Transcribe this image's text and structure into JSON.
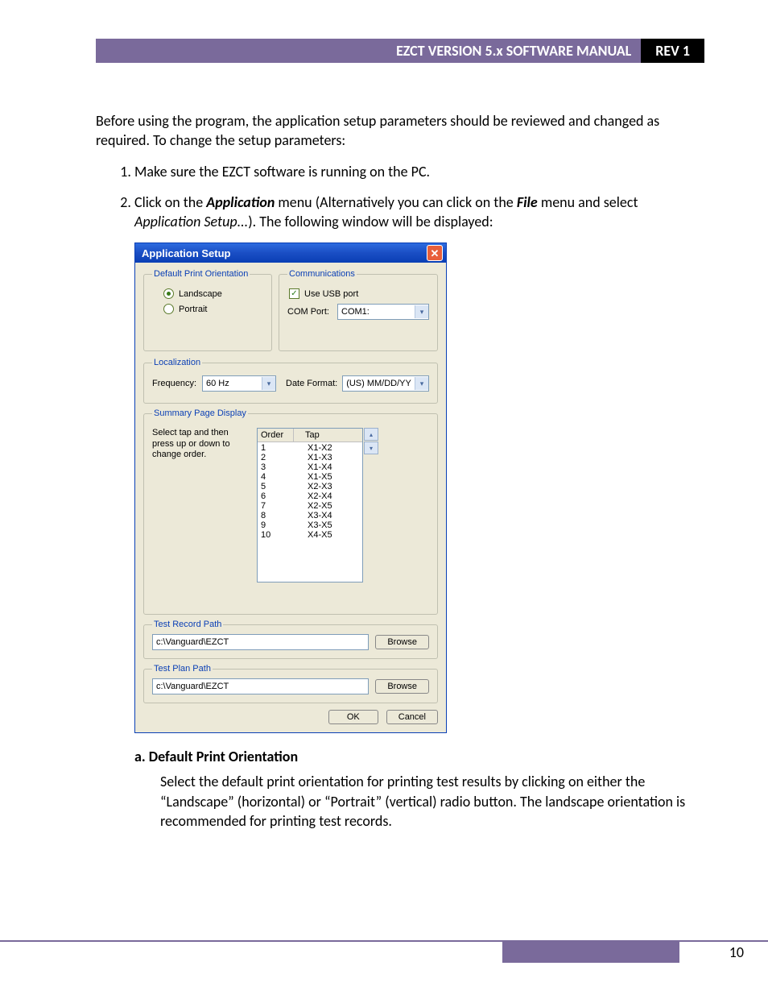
{
  "header": {
    "title": "EZCT VERSION 5.x SOFTWARE MANUAL",
    "rev": "REV 1"
  },
  "intro": "Before using the program, the application setup parameters should be reviewed and changed as required. To change the setup parameters:",
  "steps": {
    "s1": "Make sure the EZCT software is running on the PC.",
    "s2a": "Click on the ",
    "s2_app": "Application",
    "s2b": " menu (Alternatively you can click on the ",
    "s2_file": "File",
    "s2c": " menu and select ",
    "s2_setup": "Application Setup...",
    "s2d": "). The following window will be displayed:"
  },
  "dialog": {
    "title": "Application Setup",
    "close": "✕",
    "print_orient": {
      "legend": "Default Print Orientation",
      "landscape": "Landscape",
      "portrait": "Portrait"
    },
    "comms": {
      "legend": "Communications",
      "use_usb": "Use USB port",
      "com_label": "COM Port:",
      "com_value": "COM1:"
    },
    "localization": {
      "legend": "Localization",
      "freq_label": "Frequency:",
      "freq_value": "60 Hz",
      "date_label": "Date Format:",
      "date_value": "(US) MM/DD/YY"
    },
    "summary": {
      "legend": "Summary Page Display",
      "help": "Select tap and then press up or down to change order.",
      "col_order": "Order",
      "col_tap": "Tap",
      "rows": [
        {
          "o": "1",
          "t": "X1-X2"
        },
        {
          "o": "2",
          "t": "X1-X3"
        },
        {
          "o": "3",
          "t": "X1-X4"
        },
        {
          "o": "4",
          "t": "X1-X5"
        },
        {
          "o": "5",
          "t": "X2-X3"
        },
        {
          "o": "6",
          "t": "X2-X4"
        },
        {
          "o": "7",
          "t": "X2-X5"
        },
        {
          "o": "8",
          "t": "X3-X4"
        },
        {
          "o": "9",
          "t": "X3-X5"
        },
        {
          "o": "10",
          "t": "X4-X5"
        }
      ]
    },
    "record_path": {
      "legend": "Test Record Path",
      "value": "c:\\Vanguard\\EZCT",
      "browse": "Browse"
    },
    "plan_path": {
      "legend": "Test Plan Path",
      "value": "c:\\Vanguard\\EZCT",
      "browse": "Browse"
    },
    "ok": "OK",
    "cancel": "Cancel"
  },
  "section_a": {
    "heading": "a.   Default Print Orientation",
    "para": "Select the default print orientation for printing test results by clicking on either the “Landscape” (horizontal) or “Portrait” (vertical) radio button. The landscape orientation is recommended for printing test records."
  },
  "page_number": "10"
}
